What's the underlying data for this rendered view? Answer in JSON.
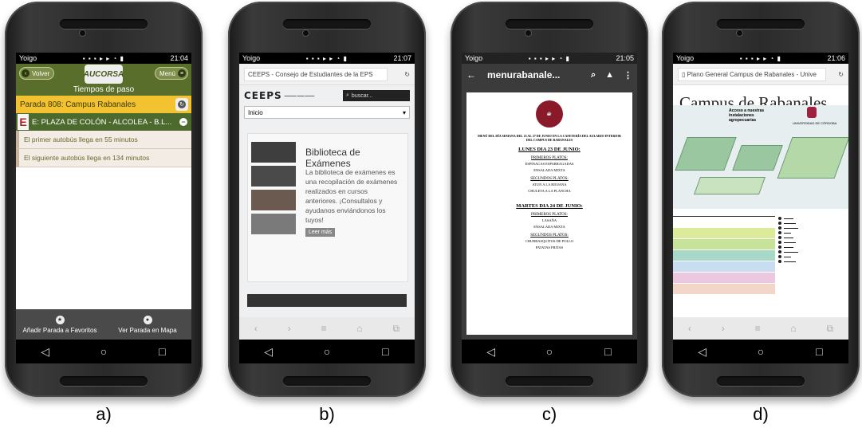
{
  "labels": [
    "a)",
    "b)",
    "c)",
    "d)"
  ],
  "nav_icons": {
    "back": "◁",
    "home": "○",
    "recent": "□"
  },
  "screen_a": {
    "status": {
      "carrier": "Yoigo",
      "time": "21:04"
    },
    "back_label": "Volver",
    "menu_label": "Menú",
    "logo_text": "AUCORSA",
    "title": "Tiempos de paso",
    "stop": "Parada 808: Campus Rabanales",
    "line_letter": "E",
    "line_name": "E: PLAZA DE COLÓN - ALCOLEA - B.L...",
    "arrivals": [
      "El primer autobús llega en 55 minutos",
      "El siguiente autobús llega en 134 minutos"
    ],
    "footer": {
      "favorites": "Añadir Parada a Favoritos",
      "map": "Ver Parada en Mapa"
    }
  },
  "screen_b": {
    "status": {
      "carrier": "Yoigo",
      "time": "21:07"
    },
    "url": "CEEPS - Consejo de Estudiantes de la EPS",
    "logo": "CEEPS",
    "search_placeholder": "buscar...",
    "menu_selected": "Inicio",
    "card_title": "Biblioteca de Exámenes",
    "card_text": "La biblioteca de exámenes es una recopilación de exámenes realizados en cursos anteriores. ¡Consultalos y ayudanos enviándonos los tuyos!",
    "more_button": "Leer más"
  },
  "screen_c": {
    "status": {
      "carrier": "Yoigo",
      "time": "21:05"
    },
    "title": "menurabanale...",
    "intro": "MENÚ DEL DÍA SEMANA DEL 23 AL 27 DE JUNIO EN LA CAFETERÍA DEL AULARIO INTERIOR DEL CAMPUS DE RABANALES",
    "days": [
      {
        "day": "LUNES DIA 23 DE JUNIO:",
        "first_label": "PRIMEROS PLATOS:",
        "first": [
          "ESPINACAS ESPARRAGADAS",
          "ENSALADA MIXTA"
        ],
        "second_label": "SEGUNDOS PLATOS:",
        "second": [
          "ATUN A LA RIOJANA",
          "CHULETA A LA PLANCHA"
        ]
      },
      {
        "day": "MARTES DIA 24 DE JUNIO:",
        "first_label": "PRIMEROS PLATOS:",
        "first": [
          "LASAÑA",
          "ENSALADA MIXTA"
        ],
        "second_label": "SEGUNDOS PLATOS:",
        "second": [
          "CHURRASQUITOS DE POLLO",
          "PATATAS FRITAS"
        ]
      }
    ]
  },
  "screen_d": {
    "status": {
      "carrier": "Yoigo",
      "time": "21:06"
    },
    "url": "Plano General Campus de Rabanales - Unive",
    "title": "Campus de Rabanales",
    "map_note": "Acceso a nuestras instalaciones agropecuarias",
    "university": "UNIVERSIDAD DE CÓRDOBA"
  }
}
